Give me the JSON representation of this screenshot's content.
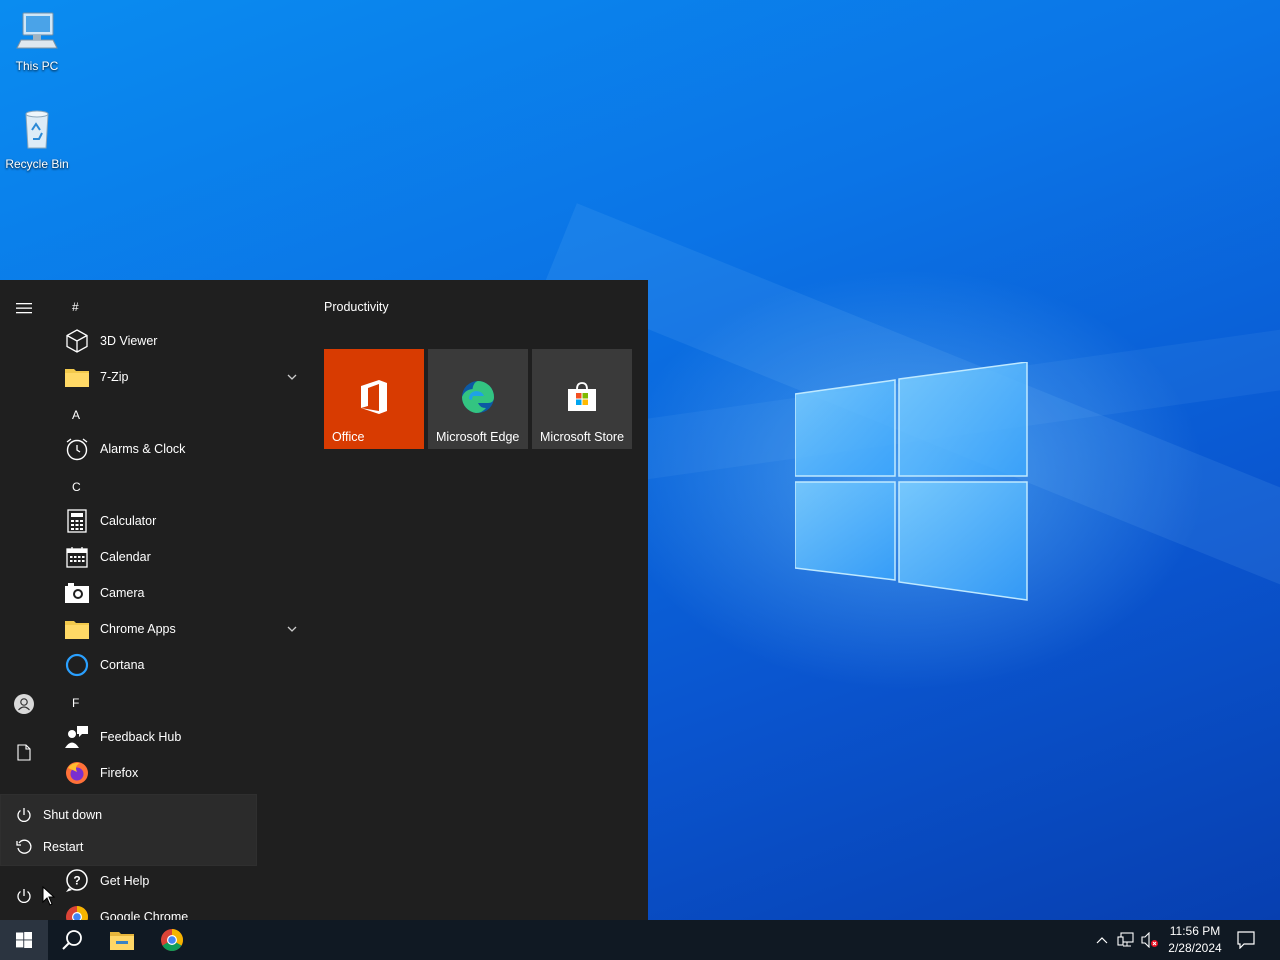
{
  "desktop": {
    "icons": [
      {
        "label": "This PC",
        "icon": "this-pc-icon"
      },
      {
        "label": "Recycle Bin",
        "icon": "recycle-bin-icon"
      }
    ]
  },
  "start_menu": {
    "rail": {
      "menu_icon": "hamburger-icon",
      "user_icon": "user-icon",
      "documents_icon": "document-icon",
      "power_icon": "power-icon"
    },
    "letters": [
      "#",
      "A",
      "C",
      "F"
    ],
    "apps": [
      {
        "label": "3D Viewer",
        "icon": "3d-viewer-icon"
      },
      {
        "label": "7-Zip",
        "icon": "folder-icon",
        "expandable": true
      },
      {
        "label": "Alarms & Clock",
        "icon": "alarm-clock-icon"
      },
      {
        "label": "Calculator",
        "icon": "calculator-icon"
      },
      {
        "label": "Calendar",
        "icon": "calendar-icon"
      },
      {
        "label": "Camera",
        "icon": "camera-icon"
      },
      {
        "label": "Chrome Apps",
        "icon": "folder-icon",
        "expandable": true
      },
      {
        "label": "Cortana",
        "icon": "cortana-icon"
      },
      {
        "label": "Feedback Hub",
        "icon": "feedback-hub-icon"
      },
      {
        "label": "Firefox",
        "icon": "firefox-icon"
      },
      {
        "label": "Get Help",
        "icon": "get-help-icon"
      },
      {
        "label": "Google Chrome",
        "icon": "chrome-icon"
      }
    ],
    "tiles_group": {
      "title": "Productivity",
      "tiles": [
        {
          "label": "Office",
          "icon": "office-icon",
          "color": "#d83b01"
        },
        {
          "label": "Microsoft Edge",
          "icon": "edge-icon",
          "color": "#3a3a3a"
        },
        {
          "label": "Microsoft Store",
          "icon": "store-icon",
          "color": "#3a3a3a"
        }
      ]
    },
    "power_menu": {
      "items": [
        {
          "label": "Shut down",
          "icon": "power-icon"
        },
        {
          "label": "Restart",
          "icon": "restart-icon"
        }
      ]
    }
  },
  "taskbar": {
    "buttons": [
      "start-icon",
      "search-icon",
      "file-explorer-icon",
      "chrome-icon"
    ],
    "tray": {
      "icons": [
        "chevron-up-icon",
        "network-icon",
        "volume-muted-icon"
      ],
      "time": "11:56 PM",
      "date": "2/28/2024",
      "notification_icon": "action-center-icon"
    }
  },
  "colors": {
    "start_bg": "#1f1f1f",
    "tile_bg": "#3a3a3a",
    "office_tile": "#d83b01",
    "taskbar_bg": "#101923",
    "flyout_bg": "#2b2b2b"
  }
}
